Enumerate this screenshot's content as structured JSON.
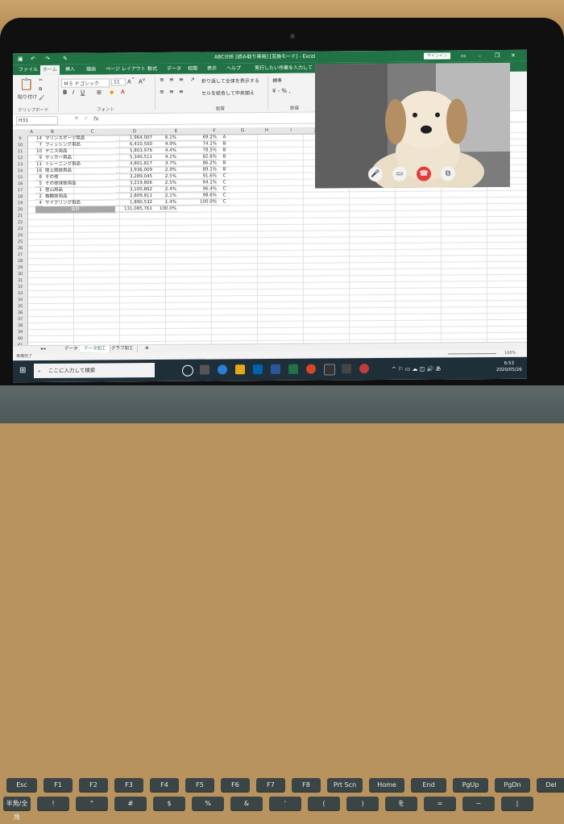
{
  "window": {
    "title": "ABC分析 [読み取り専用] [互換モード] - Excel",
    "signin_label": "サインイン"
  },
  "ribbon_tabs": [
    "ファイル",
    "ホーム",
    "挿入",
    "描画",
    "ページ レイアウト",
    "数式",
    "データ",
    "校閲",
    "表示",
    "ヘルプ"
  ],
  "tell_me": "実行したい作業を入力して",
  "ribbon": {
    "paste_label": "貼り付け",
    "clipboard_group": "クリップボード",
    "font_name": "ＭＳ Ｐゴシック",
    "font_size": "11",
    "font_group": "フォント",
    "wrap_text": "折り返して全体を表示する",
    "merge_center": "セルを結合して中央揃え",
    "alignment_group": "配置",
    "number_format": "標準",
    "number_group": "数値"
  },
  "formula_bar": {
    "name_box": "H31",
    "fx": "fx"
  },
  "columns": [
    "A",
    "B",
    "C",
    "D",
    "E",
    "F",
    "G",
    "H",
    "I",
    "J"
  ],
  "rows": [
    "9",
    "10",
    "11",
    "12",
    "13",
    "14",
    "15",
    "16",
    "17",
    "18",
    "19",
    "20",
    "21",
    "22",
    "23",
    "24",
    "25",
    "26",
    "27",
    "28",
    "29",
    "30",
    "31",
    "32",
    "33",
    "34",
    "35",
    "36",
    "37",
    "38",
    "39",
    "40",
    "41",
    "42",
    "43"
  ],
  "table_rows": [
    {
      "rank": "14",
      "name": "マリンスポーツ用品",
      "value": "1,964,007",
      "pct": "6.1%",
      "cum": "69.2%",
      "cls": "A"
    },
    {
      "rank": "7",
      "name": "フィッシング用品",
      "value": "6,410,500",
      "pct": "4.9%",
      "cum": "74.1%",
      "cls": "B"
    },
    {
      "rank": "10",
      "name": "テニス用品",
      "value": "5,803,976",
      "pct": "4.4%",
      "cum": "78.5%",
      "cls": "B"
    },
    {
      "rank": "9",
      "name": "サッカー用品",
      "value": "5,340,511",
      "pct": "4.1%",
      "cum": "82.6%",
      "cls": "B"
    },
    {
      "rank": "11",
      "name": "トレーニング用品",
      "value": "4,801,817",
      "pct": "3.7%",
      "cum": "86.2%",
      "cls": "B"
    },
    {
      "rank": "16",
      "name": "陸上競技用品",
      "value": "3,936,009",
      "pct": "2.9%",
      "cum": "89.1%",
      "cls": "B"
    },
    {
      "rank": "8",
      "name": "その他",
      "value": "3,289,045",
      "pct": "2.5%",
      "cum": "91.6%",
      "cls": "C"
    },
    {
      "rank": "5",
      "name": "その他球技用品",
      "value": "3,219,806",
      "pct": "2.5%",
      "cum": "94.1%",
      "cls": "C"
    },
    {
      "rank": "1",
      "name": "登山用品",
      "value": "3,100,862",
      "pct": "2.4%",
      "cum": "96.4%",
      "cls": "C"
    },
    {
      "rank": "2",
      "name": "格闘技用品",
      "value": "2,809,811",
      "pct": "2.1%",
      "cum": "98.6%",
      "cls": "C"
    },
    {
      "rank": "4",
      "name": "サイクリング用品",
      "value": "1,890,532",
      "pct": "1.4%",
      "cum": "100.0%",
      "cls": "C"
    }
  ],
  "total": {
    "label": "合計",
    "value": "131,085,761",
    "pct": "100.0%"
  },
  "sheet_tabs": [
    "データ",
    "データ加工",
    "グラフ加工"
  ],
  "status": {
    "left": "準備完了",
    "zoom": "100%"
  },
  "taskbar": {
    "search_placeholder": "ここに入力して検索",
    "time": "6:53",
    "date": "2020/05/26"
  },
  "keyboard": {
    "fn_row": [
      "Esc",
      "F1",
      "F2",
      "F3",
      "F4",
      "F5",
      "F6",
      "F7",
      "F8",
      "Prt Scn",
      "Home",
      "End",
      "PgUp",
      "PgDn",
      "Del"
    ],
    "num_row": [
      "半角/全角",
      "!",
      "\"",
      "#",
      "$",
      "%",
      "&",
      "'",
      "(",
      ")",
      "を",
      "=",
      "~",
      "|"
    ]
  }
}
